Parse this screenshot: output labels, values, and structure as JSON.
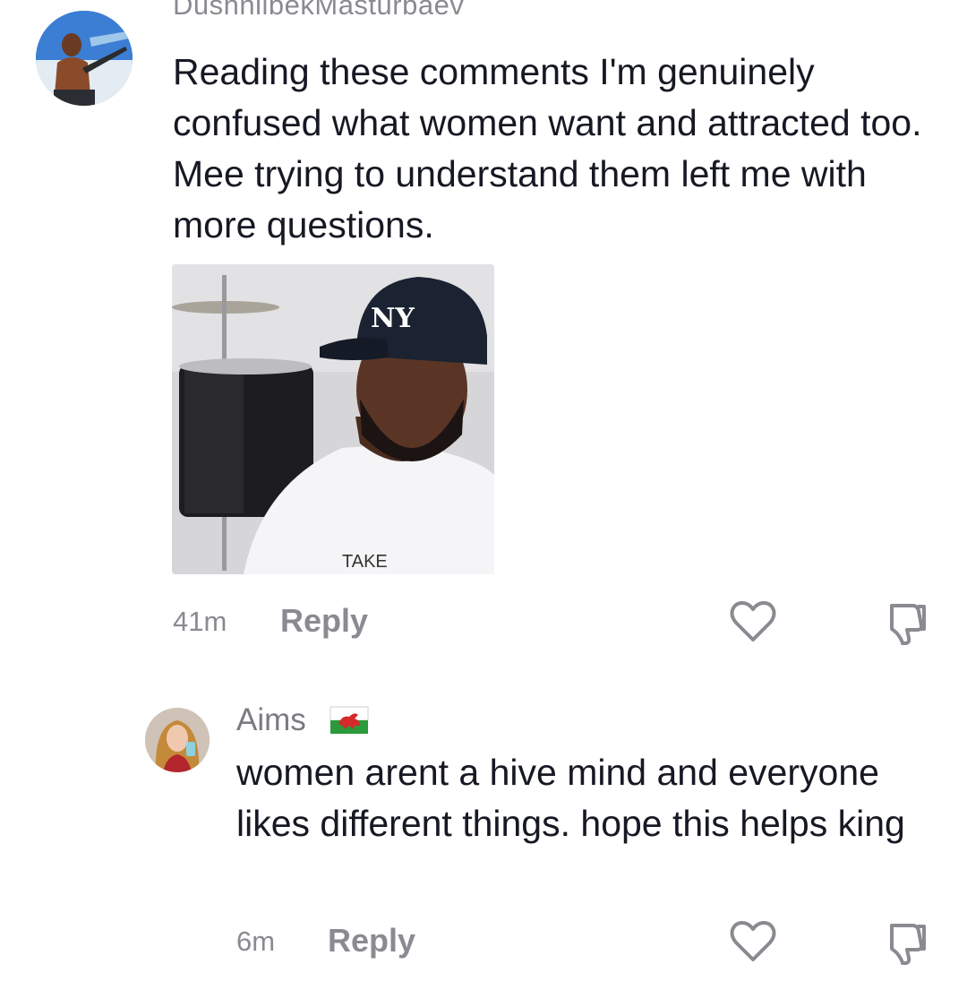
{
  "comments": [
    {
      "username": "DushnilbekMasturbaev",
      "text": "Reading these comments I'm genuinely confused what women want and attracted too. Mee trying to understand them left me with more questions.",
      "time": "41m",
      "reply_label": "Reply",
      "photo_shirt_text": "TAKE"
    },
    {
      "username": "Aims",
      "text": "women arent a hive mind and everyone likes different things. hope this helps king",
      "time": "6m",
      "reply_label": "Reply"
    }
  ],
  "icons": {
    "like": "heart-outline-icon",
    "dislike": "thumbs-down-icon"
  },
  "colors": {
    "text": "#161823",
    "secondary": "#8a8b91"
  }
}
